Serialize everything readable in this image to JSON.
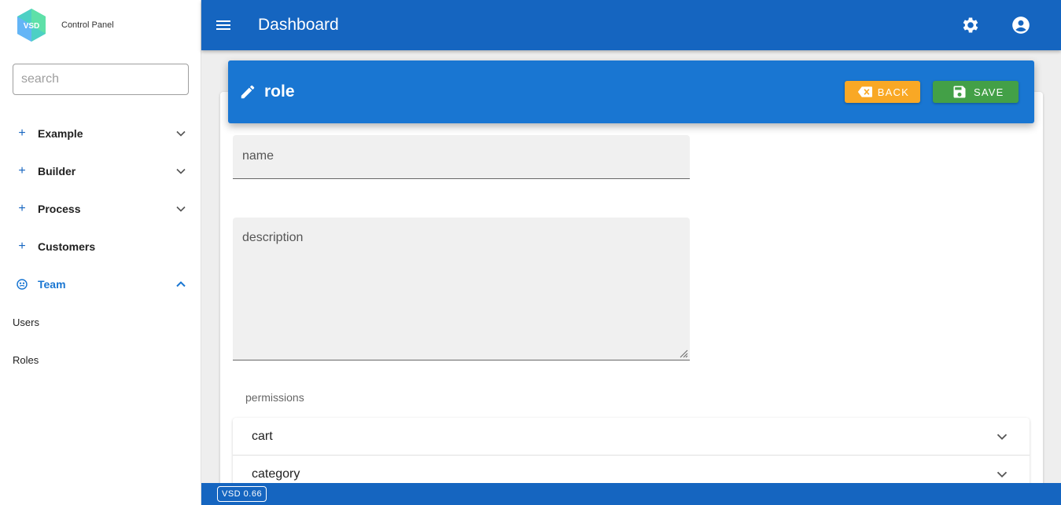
{
  "brand": {
    "logo_text": "VSD",
    "title": "Control Panel"
  },
  "search": {
    "placeholder": "search",
    "value": ""
  },
  "nav": {
    "items": [
      {
        "label": "Example",
        "icon": "plus-icon"
      },
      {
        "label": "Builder",
        "icon": "plus-icon"
      },
      {
        "label": "Process",
        "icon": "plus-icon"
      },
      {
        "label": "Customers",
        "icon": "plus-icon"
      },
      {
        "label": "Team",
        "icon": "team-icon",
        "expanded": true
      }
    ],
    "sub_items": [
      {
        "label": "Users"
      },
      {
        "label": "Roles"
      }
    ]
  },
  "topbar": {
    "title": "Dashboard",
    "icons": [
      "menu-icon",
      "gear-icon",
      "account-icon"
    ]
  },
  "form": {
    "header_title": "role",
    "back_label": "BACK",
    "save_label": "SAVE",
    "name_placeholder": "name",
    "description_placeholder": "description",
    "permissions_label": "permissions",
    "permissions": [
      {
        "name": "cart"
      },
      {
        "name": "category"
      }
    ]
  },
  "footer": {
    "version": "VSD 0.66"
  },
  "colors": {
    "primary": "#1565c0",
    "header": "#1976d2",
    "back": "#f9a825",
    "save": "#43a047",
    "active_nav": "#1976d2"
  }
}
